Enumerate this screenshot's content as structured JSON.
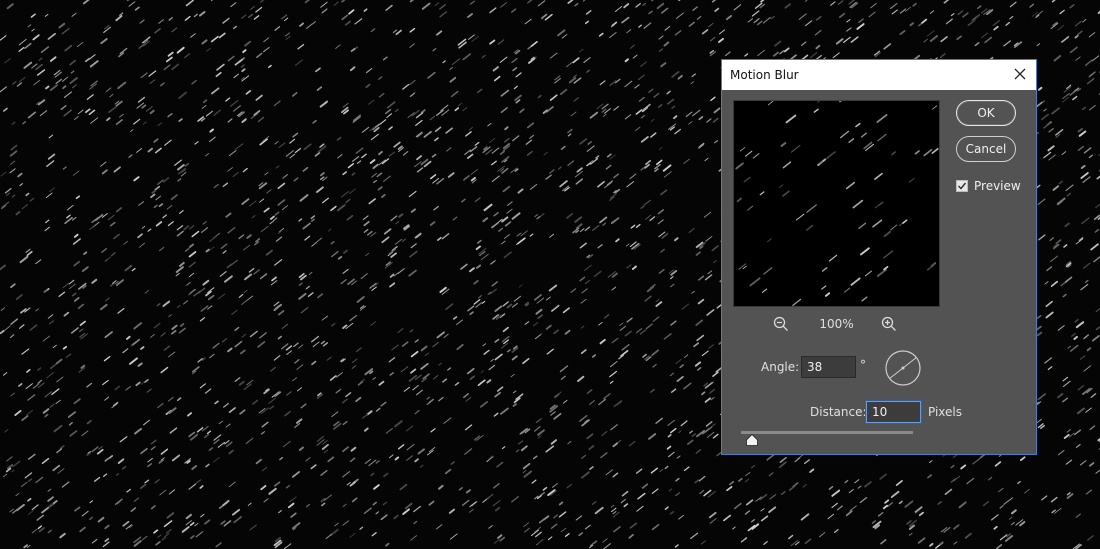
{
  "dialog": {
    "title": "Motion Blur",
    "ok_label": "OK",
    "cancel_label": "Cancel",
    "preview_label": "Preview",
    "preview_checked": true,
    "zoom_level": "100%",
    "angle": {
      "label": "Angle:",
      "value": "38",
      "unit": "°"
    },
    "distance": {
      "label": "Distance:",
      "value": "10",
      "unit": "Pixels",
      "slider_fraction": 0.03
    }
  },
  "colors": {
    "dialog_bg": "#535353",
    "accent_border": "#4a7fbf",
    "canvas_bg": "#050505"
  },
  "icons": [
    "close-icon",
    "zoom-out-icon",
    "zoom-in-icon",
    "check-icon",
    "angle-wheel-icon",
    "slider-thumb-icon"
  ]
}
